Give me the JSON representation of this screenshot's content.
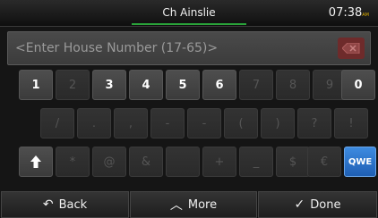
{
  "header": {
    "title": "Ch Ainslie",
    "time": "07:38",
    "ampm": "AM"
  },
  "input": {
    "placeholder": "<Enter House Number (17-65)>"
  },
  "keys": {
    "row1": [
      "1",
      "2",
      "3",
      "4",
      "5",
      "6",
      "7",
      "8",
      "9",
      "0"
    ],
    "row2": [
      "/",
      ".",
      ",",
      "-",
      "-",
      "(",
      ")",
      "?",
      "!"
    ],
    "row3": [
      "↑",
      "*",
      "@",
      "&",
      "",
      "+",
      "_",
      "$",
      "€",
      "QWE"
    ]
  },
  "footer": {
    "back_label": "Back",
    "more_label": "More",
    "done_label": "Done"
  },
  "colors": {
    "accent_green": "#2aa43a",
    "mode_blue": "#2f74cc",
    "backspace_red": "#6e2b2b"
  }
}
